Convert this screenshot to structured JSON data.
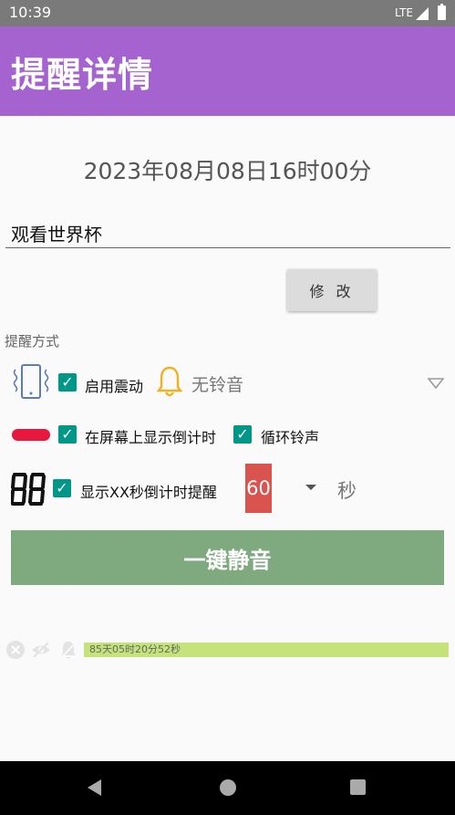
{
  "status_bar": {
    "time": "10:39",
    "network": "LTE"
  },
  "app_bar": {
    "title": "提醒详情"
  },
  "reminder": {
    "datetime": "2023年08月08日16时00分",
    "title_value": "观看世界杯",
    "modify_label": "修 改"
  },
  "method": {
    "label": "提醒方式",
    "vibrate_label": "启用震动",
    "ringtone_value": "无铃音",
    "countdown_label": "在屏幕上显示倒计时",
    "loop_label": "循环铃声",
    "xx_label": "显示XX秒倒计时提醒",
    "seconds_value": "60",
    "seconds_unit": "秒"
  },
  "mute_button": {
    "label": "一键静音"
  },
  "countdown": {
    "text": "85天05时20分52秒"
  },
  "colors": {
    "app_bar": "#a463ce",
    "checkbox": "#009688",
    "mute_button": "#7fa97e",
    "seconds_box": "#d9534f",
    "progress": "#c5e37a",
    "pill": "#e8173d"
  },
  "icons": [
    "vibrate-icon",
    "bell-icon",
    "pill-icon",
    "digits-icon",
    "close-circle-icon",
    "eye-off-icon",
    "bell-off-icon"
  ]
}
